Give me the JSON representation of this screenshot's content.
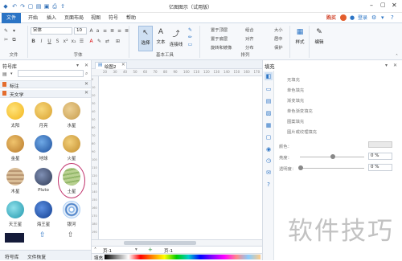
{
  "window": {
    "title": "亿图图示（试用版）"
  },
  "menu": {
    "tabs": [
      "文件",
      "开始",
      "插入",
      "页面布局",
      "视图",
      "符号",
      "帮助"
    ],
    "active": "文件",
    "right": {
      "buy": "购买",
      "login": "登录"
    }
  },
  "ribbon": {
    "font_name": "宋体",
    "font_size": "10",
    "groups": {
      "file": "文件",
      "font": "字体",
      "basic_tools": "基本工具",
      "arrange": "排列"
    },
    "tools": {
      "select": "选择",
      "text": "文本",
      "connector": "连接线"
    },
    "arrange_items": [
      "置于顶层",
      "置于底层",
      "旋转和镜像",
      "组合",
      "对齐",
      "分布",
      "大小",
      "居中",
      "保护"
    ],
    "style": "样式",
    "edit": "编辑"
  },
  "library": {
    "title": "符号库",
    "sections": [
      "标注",
      "天文学"
    ],
    "symbols": [
      {
        "label": "太阳",
        "color": "#f2c230"
      },
      {
        "label": "月亮",
        "color": "#e2b43a"
      },
      {
        "label": "水星",
        "color": "#d6ad5c"
      },
      {
        "label": "金星",
        "color": "#d9a84e"
      },
      {
        "label": "地球",
        "color": "#2f6cb8"
      },
      {
        "label": "火星",
        "color": "#d49c3a"
      },
      {
        "label": "木星",
        "color": "#c9a77d"
      },
      {
        "label": "Pluto",
        "color": "#4a5878"
      },
      {
        "label": "土星",
        "color": "#a7c47e"
      },
      {
        "label": "天王星",
        "color": "#3bb5c8"
      },
      {
        "label": "海王星",
        "color": "#1d56b5"
      },
      {
        "label": "银河",
        "color": "#2d6dc0"
      }
    ],
    "bottom_tabs": [
      "符号库",
      "文件恢复"
    ]
  },
  "document": {
    "tab": "绘图2",
    "page_tabs": [
      "页-1",
      "页-1"
    ],
    "fill_label": "填充",
    "ruler_top": [
      "20",
      "30",
      "40",
      "50",
      "60",
      "70",
      "80",
      "90",
      "100",
      "110",
      "120",
      "130",
      "140",
      "150",
      "160",
      "170"
    ],
    "ruler_left": [
      "0",
      "10",
      "20",
      "30",
      "40",
      "50",
      "60",
      "70",
      "80",
      "90",
      "100",
      "110",
      "120",
      "130",
      "140",
      "150",
      "160",
      "170",
      "180",
      "190"
    ]
  },
  "fill_panel": {
    "title": "填充",
    "options": [
      "无填充",
      "单色填充",
      "渐变填充",
      "单色渐变填充",
      "图案填充",
      "图片或纹理填充"
    ],
    "color_label": "颜色：",
    "brightness_label": "亮度：",
    "transparency_label": "透明度：",
    "brightness_value": "0 %",
    "transparency_value": "0 %"
  },
  "watermark": "软件技巧",
  "colors": {
    "accent": "#2b74c5",
    "selection": "#c0306a"
  }
}
